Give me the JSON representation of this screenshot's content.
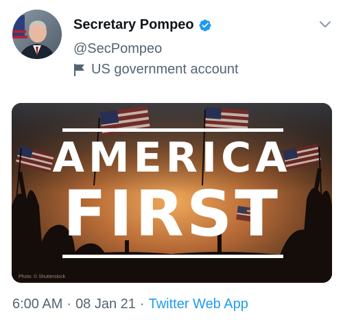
{
  "tweet": {
    "author": {
      "display_name": "Secretary Pompeo",
      "handle": "@SecPompeo",
      "label": "US government account"
    },
    "media": {
      "headline_line1": "AMERICA",
      "headline_line2": "FIRST",
      "photo_credit": "Photo: © Shutterstock"
    },
    "footer": {
      "time": "6:00 AM",
      "separator": "·",
      "date": "08 Jan 21",
      "source": "Twitter Web App"
    },
    "icons": {
      "verified": "verified-badge-icon",
      "government": "flag-icon",
      "more": "chevron-down-icon"
    },
    "colors": {
      "verified_blue": "#1d9bf0",
      "muted_text": "#536471",
      "link_blue": "#1d9bf0"
    }
  }
}
